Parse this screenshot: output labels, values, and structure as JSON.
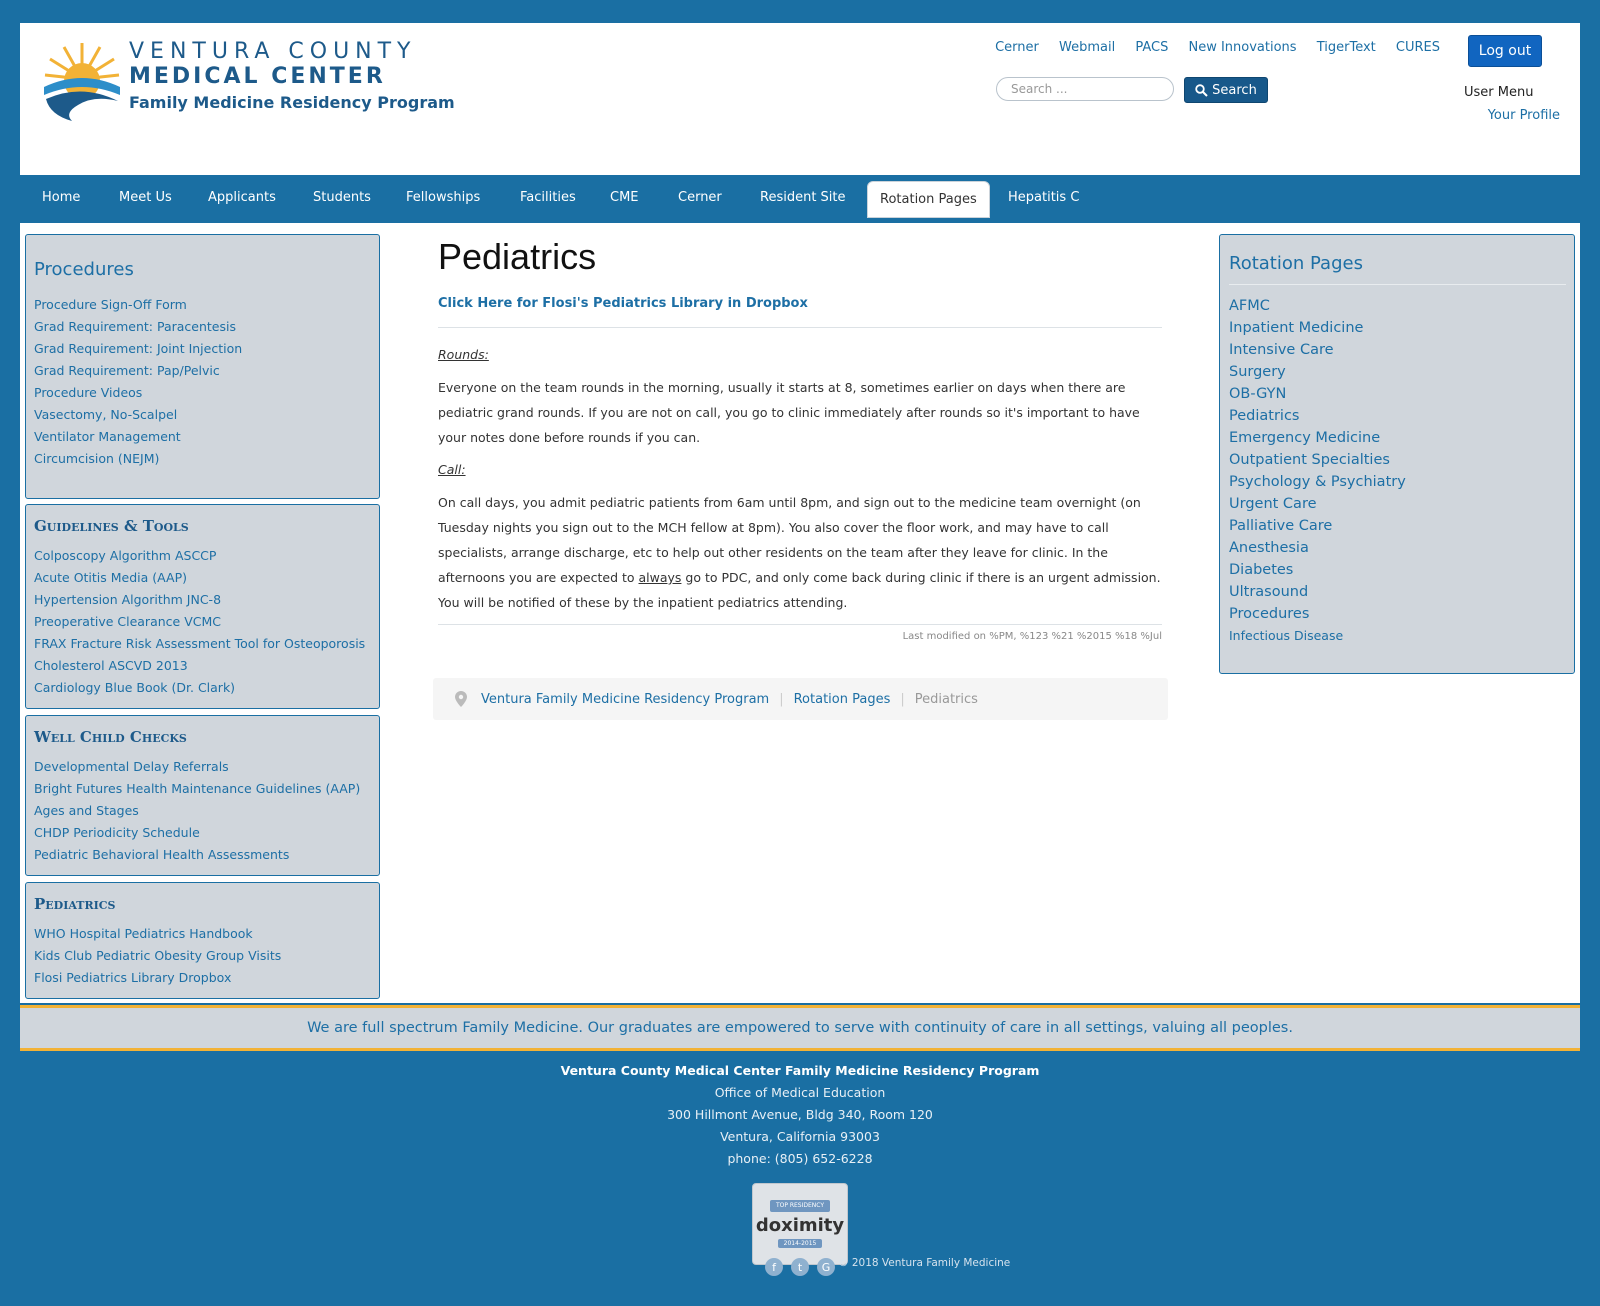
{
  "logo": {
    "line1": "VENTURA COUNTY",
    "line2": "MEDICAL CENTER",
    "line3": "Family Medicine Residency Program"
  },
  "toplinks": [
    "Cerner",
    "Webmail",
    "PACS",
    "New Innovations",
    "TigerText",
    "CURES"
  ],
  "logout": "Log out",
  "search": {
    "placeholder": "Search ...",
    "button": "Search"
  },
  "user_menu": {
    "title": "User Menu",
    "profile": "Your Profile"
  },
  "nav": [
    "Home",
    "Meet Us",
    "Applicants",
    "Students",
    "Fellowships",
    "Facilities",
    "CME",
    "Cerner",
    "Resident Site",
    "Rotation Pages",
    "Hepatitis C"
  ],
  "nav_active": "Rotation Pages",
  "left": {
    "procedures": {
      "title": "Procedures",
      "items": [
        "Procedure Sign-Off Form",
        "Grad Requirement: Paracentesis",
        "Grad Requirement: Joint Injection",
        "Grad Requirement: Pap/Pelvic",
        "Procedure Videos",
        "Vasectomy, No-Scalpel",
        "Ventilator Management",
        "Circumcision (NEJM)"
      ]
    },
    "guidelines": {
      "title": "Guidelines & Tools",
      "items": [
        "Colposcopy Algorithm ASCCP",
        "Acute Otitis Media (AAP)",
        "Hypertension Algorithm JNC-8",
        "Preoperative Clearance VCMC",
        "FRAX Fracture Risk Assessment Tool for Osteoporosis",
        "Cholesterol ASCVD 2013",
        "Cardiology Blue Book (Dr. Clark)"
      ]
    },
    "wellchild": {
      "title": "Well Child Checks",
      "items": [
        "Developmental Delay Referrals",
        "Bright Futures Health Maintenance Guidelines (AAP)",
        "Ages and Stages",
        "CHDP Periodicity Schedule",
        "Pediatric Behavioral Health Assessments"
      ]
    },
    "pediatrics": {
      "title": "Pediatrics",
      "items": [
        "WHO Hospital Pediatrics Handbook",
        "Kids Club Pediatric Obesity Group Visits",
        "Flosi Pediatrics Library Dropbox"
      ]
    }
  },
  "main": {
    "title": "Pediatrics",
    "dropbox_link": "Click Here for Flosi's Pediatrics Library in Dropbox",
    "rounds_label": "Rounds:",
    "rounds_text": "Everyone on the team rounds in the morning, usually it starts at 8, sometimes earlier on days when there are pediatric grand rounds.  If you are not on call, you go to clinic immediately after rounds so it's important to have your notes done before rounds if you can.",
    "call_label": "Call:",
    "call_text_1": "On call days, you admit pediatric patients from 6am until 8pm, and sign out to the medicine team overnight (on Tuesday nights you sign out to the MCH fellow at 8pm).  You also cover the floor work, and may have to call specialists, arrange discharge, etc to help out other residents on the team after they leave for clinic.  In the afternoons you are expected to ",
    "call_text_always": "always",
    "call_text_2": " go to PDC, and only come back during clinic if there is an urgent admission.  You will be notified of these by the inpatient pediatrics attending.",
    "last_modified": "Last modified on %PM, %123 %21 %2015 %18 %Jul"
  },
  "breadcrumb": [
    "Ventura Family Medicine Residency Program",
    "Rotation Pages",
    "Pediatrics"
  ],
  "right": {
    "title": "Rotation Pages",
    "items": [
      "AFMC",
      "Inpatient Medicine",
      "Intensive Care",
      "Surgery",
      "OB-GYN",
      "Pediatrics",
      "Emergency Medicine",
      "Outpatient Specialties",
      "Psychology & Psychiatry",
      "Urgent Care",
      "Palliative Care",
      "Anesthesia",
      "Diabetes",
      "Ultrasound",
      "Procedures"
    ],
    "last_item": "Infectious Disease"
  },
  "footer": {
    "tagline": "We are full spectrum Family Medicine. Our graduates are empowered to serve with continuity of care in all settings, valuing all peoples.",
    "org": "Ventura County Medical Center Family Medicine Residency Program",
    "office": "Office of Medical Education",
    "street": "300 Hillmont Avenue, Bldg 340, Room 120",
    "city": "Ventura, California 93003",
    "phone": "phone: (805) 652-6228",
    "badge": {
      "top": "TOP RESIDENCY",
      "name": "doximity",
      "years": "2014-2015"
    },
    "copyright": "© 2018 Ventura Family Medicine"
  }
}
